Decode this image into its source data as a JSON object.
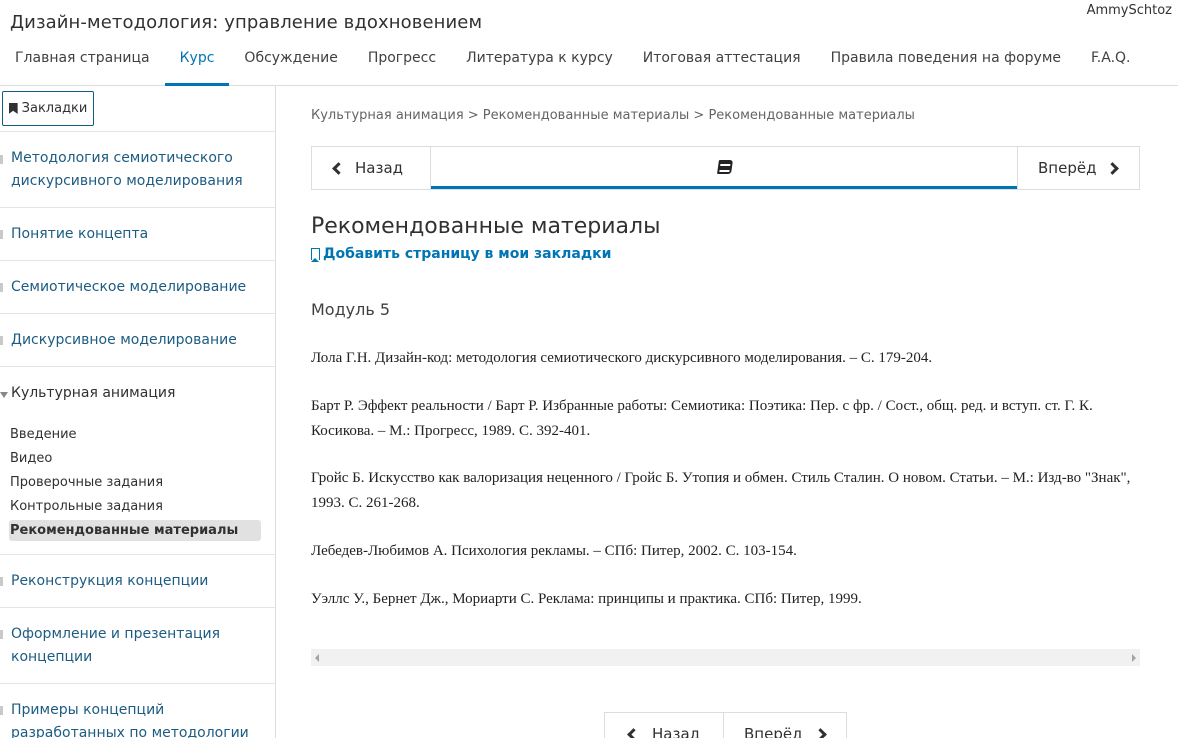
{
  "header": {
    "course_title": "Дизайн-методология: управление вдохновением",
    "username": "AmmySchtoz",
    "tabs": [
      {
        "label": "Главная страница",
        "active": false
      },
      {
        "label": "Курс",
        "active": true
      },
      {
        "label": "Обсуждение",
        "active": false
      },
      {
        "label": "Прогресс",
        "active": false
      },
      {
        "label": "Литература к курсу",
        "active": false
      },
      {
        "label": "Итоговая аттестация",
        "active": false
      },
      {
        "label": "Правила поведения на форуме",
        "active": false
      },
      {
        "label": "F.A.Q.",
        "active": false
      }
    ]
  },
  "sidebar": {
    "bookmarks_label": "Закладки",
    "sections": [
      {
        "label": "Методология семиотического дискурсивного моделирования"
      },
      {
        "label": "Понятие концепта"
      },
      {
        "label": "Семиотическое моделирование"
      },
      {
        "label": "Дискурсивное моделирование"
      },
      {
        "label": "Культурная анимация",
        "expanded": true
      },
      {
        "label": "Реконструкция концепции"
      },
      {
        "label": "Оформление и презентация концепции"
      },
      {
        "label": "Примеры концепций разработанных по методологии"
      }
    ],
    "subsections": [
      {
        "label": "Введение"
      },
      {
        "label": "Видео"
      },
      {
        "label": "Проверочные задания"
      },
      {
        "label": "Контрольные задания"
      },
      {
        "label": "Рекомендованные материалы",
        "active": true
      }
    ]
  },
  "main": {
    "breadcrumb": "Культурная анимация > Рекомендованные материалы > Рекомендованные материалы",
    "prev_label": "Назад",
    "next_label": "Вперёд",
    "unit_title": "Рекомендованные материалы",
    "add_bookmark_label": "Добавить страницу в мои закладки",
    "module_label": "Модуль 5",
    "references": [
      "Лола Г.Н. Дизайн-код: методология семиотического дискурсивного моделирования. – С. 179-204.",
      "Барт Р. Эффект реальности / Барт Р. Избранные работы: Семиотика: Поэтика: Пер. с фр. / Сост., общ. ред. и вступ. ст. Г. К. Косикова. –  М.: Прогресс, 1989. С. 392-401.",
      "Гройс Б. Искусство как валоризация неценного / Гройс Б. Утопия и обмен.  Стиль Сталин. О новом. Статьи. – М.: Изд-во \"Знак\", 1993. С. 261-268.",
      "Лебедев-Любимов А. Психология рекламы. – СПб: Питер, 2002. С. 103-154.",
      "Уэллс У.,  Бернет Дж.,  Мориарти С. Реклама: принципы и практика. СПб: Питер, 1999."
    ],
    "bottom_prev_label": "Назад",
    "bottom_next_label": "Вперёд"
  },
  "colors": {
    "accent": "#0075b4",
    "sidebar_link": "#1d5c82",
    "active_item_bg": "#e1e1e1"
  }
}
